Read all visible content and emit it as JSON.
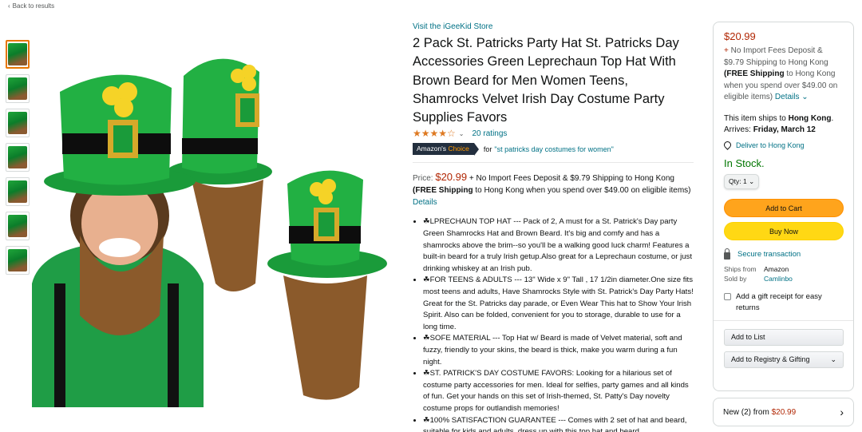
{
  "nav": {
    "back_label": "Back to results"
  },
  "thumbnails": [
    "thumb-1",
    "thumb-2",
    "thumb-3",
    "thumb-4",
    "thumb-5",
    "thumb-6",
    "thumb-7"
  ],
  "product": {
    "store_link": "Visit the iGeeKid Store",
    "title": "2 Pack St. Patricks Party Hat St. Patricks Day Accessories Green Leprechaun Top Hat With Brown Beard for Men Women Teens, Shamrocks Velvet Irish Day Costume Party Supplies Favors",
    "rating_stars": "★★★★☆",
    "ratings_count": "20 ratings",
    "choice_badge_prefix": "Amazon's",
    "choice_badge_suffix": "Choice",
    "choice_for": "for",
    "choice_keyword": "\"st patricks day costumes for women\"",
    "price_label": "Price:",
    "price": "$20.99",
    "price_note": "+ No Import Fees Deposit & $9.79 Shipping to Hong Kong",
    "free_shipping_bold": "(FREE Shipping",
    "free_shipping_rest": "to Hong Kong when you spend over $49.00 on eligible items)",
    "details_link": "Details",
    "bullets": [
      "☘LPRECHAUN TOP HAT --- Pack of 2, A must for a St. Patrick's Day party Green Shamrocks Hat and Brown Beard. It's big and comfy and has a shamrocks above the brim--so you'll be a walking good luck charm! Features a built-in beard for a truly Irish getup.Also great for a Leprechaun costume, or just drinking whiskey at an Irish pub.",
      "☘FOR TEENS & ADULTS --- 13\" Wide x 9\" Tall , 17 1/2in diameter.One size fits most teens and adults, Have Shamrocks Style with St. Patrick's Day Party Hats! Great for the St. Patricks day parade, or Even Wear This hat to Show Your Irish Spirit. Also can be folded, convenient for you to storage, durable to use for a long time.",
      "☘SOFE MATERIAL --- Top Hat w/ Beard is made of Velvet material, soft and fuzzy, friendly to your skins, the beard is thick, make you warm during a fun night.",
      "☘ST. PATRICK'S DAY COSTUME FAVORS: Looking for a hilarious set of costume party accessories for men. Ideal for selfies, party games and all kinds of fun. Get your hands on this set of Irish-themed, St. Patty's Day novelty costume props for outlandish memories!",
      "☘100% SATISFACTION GUARANTEE --- Comes with 2 set of hat and beard, suitable for kids and adults, dress up with this top hat and beard,"
    ]
  },
  "buybox": {
    "price": "$20.99",
    "plus": "+",
    "import_note": "No Import Fees Deposit & $9.79 Shipping to Hong Kong",
    "free_bold": "(FREE Shipping",
    "free_rest": "to Hong Kong when you spend over $49.00 on eligible items)",
    "details": "Details",
    "ships_prefix": "This item ships to",
    "ships_country": "Hong Kong",
    "arrives_prefix": ". Arrives:",
    "arrives_date": "Friday, March 12",
    "deliver_to": "Deliver to Hong Kong",
    "in_stock": "In Stock.",
    "qty_label": "Qty: 1",
    "add_to_cart": "Add to Cart",
    "buy_now": "Buy Now",
    "secure": "Secure transaction",
    "ships_from_label": "Ships from",
    "ships_from_value": "Amazon",
    "sold_by_label": "Sold by",
    "sold_by_value": "Camlinbo",
    "gift_receipt": "Add a gift receipt for easy returns",
    "add_to_list": "Add to List",
    "add_to_registry": "Add to Registry & Gifting"
  },
  "new_offers": {
    "label": "New (2) from",
    "price": "$20.99"
  },
  "colors": {
    "accent_link": "#007185",
    "price_red": "#b12704",
    "in_stock": "#007600",
    "cart_btn": "#ffa41c",
    "buy_btn": "#ffd814"
  }
}
